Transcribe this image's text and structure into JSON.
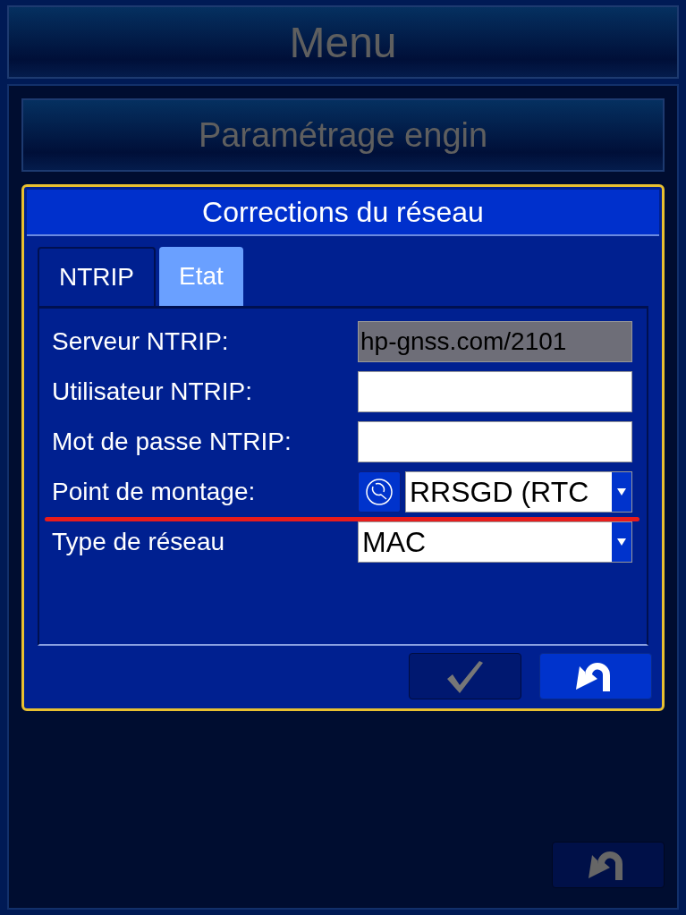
{
  "header": {
    "title": "Menu"
  },
  "subheader": {
    "title": "Paramétrage engin"
  },
  "dialog": {
    "title": "Corrections du réseau",
    "tabs": [
      {
        "label": "NTRIP",
        "selected": true
      },
      {
        "label": "Etat",
        "selected": false
      }
    ],
    "fields": [
      {
        "label": "Serveur NTRIP:",
        "kind": "text",
        "value": "hp-gnss.com/2101",
        "disabled": true
      },
      {
        "label": "Utilisateur NTRIP:",
        "kind": "text",
        "disabled": false
      },
      {
        "label": "Mot de passe NTRIP:",
        "kind": "text",
        "disabled": false
      },
      {
        "label": "Point de montage:",
        "kind": "dropdown",
        "tool": true,
        "value": "RRSGD (RTC",
        "underlined": true
      },
      {
        "label": "Type de réseau",
        "kind": "dropdown",
        "tool": false,
        "value": "MAC",
        "underlined": false
      }
    ],
    "buttons": [
      {
        "kind": "confirm",
        "disabled": true
      },
      {
        "kind": "back",
        "disabled": false
      }
    ]
  },
  "footer_buttons": [
    {
      "kind": "back",
      "disabled": true
    }
  ]
}
